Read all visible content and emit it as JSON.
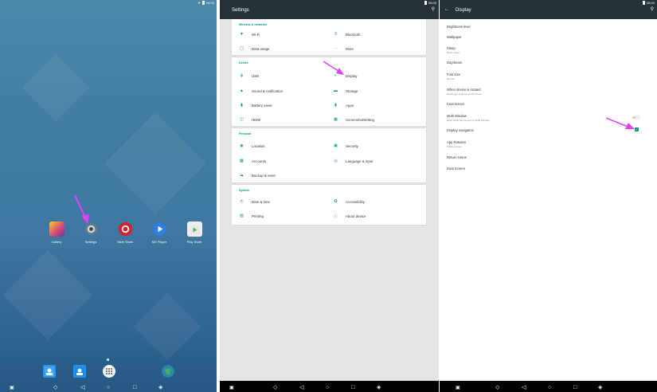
{
  "status": {
    "time": "08:00"
  },
  "home": {
    "apps": [
      {
        "label": "Gallery",
        "icon": "gallery-icon",
        "color": "#d94a7a"
      },
      {
        "label": "Settings",
        "icon": "gear-icon",
        "color": "#546e7a"
      },
      {
        "label": "Slide Show",
        "icon": "slideshow-icon",
        "color": "#e01b2d"
      },
      {
        "label": "MX Player",
        "icon": "play-icon",
        "color": "#2f7de0"
      },
      {
        "label": "Play Store",
        "icon": "play-store-icon",
        "color": "#f0f0f0"
      }
    ],
    "dock": [
      {
        "icon": "contacts-icon"
      },
      {
        "icon": "contacts2-icon"
      },
      {
        "icon": "app-drawer-icon"
      },
      {
        "icon": "browser-globe-icon"
      }
    ],
    "nav": [
      "screenshot-icon",
      "volume-down-icon",
      "back-icon",
      "home-icon",
      "recents-icon",
      "volume-up-icon"
    ]
  },
  "settings": {
    "title": "Settings",
    "sections": [
      {
        "header": "Wireless & networks",
        "items": [
          {
            "label": "Wi-Fi",
            "icon": "wifi-icon"
          },
          {
            "label": "Bluetooth",
            "icon": "bluetooth-icon"
          },
          {
            "label": "Data usage",
            "icon": "data-usage-icon"
          },
          {
            "label": "More",
            "icon": "more-icon"
          }
        ]
      },
      {
        "header": "Device",
        "items": [
          {
            "label": "USB",
            "icon": "usb-icon"
          },
          {
            "label": "Display",
            "icon": "display-icon"
          },
          {
            "label": "Sound & notification",
            "icon": "sound-icon"
          },
          {
            "label": "Storage",
            "icon": "storage-icon"
          },
          {
            "label": "Battery saver",
            "icon": "battery-icon"
          },
          {
            "label": "Apps",
            "icon": "apps-icon"
          },
          {
            "label": "HDMI",
            "icon": "hdmi-icon"
          },
          {
            "label": "ScreenshotSetting",
            "icon": "screenshot-setting-icon"
          }
        ]
      },
      {
        "header": "Personal",
        "items": [
          {
            "label": "Location",
            "icon": "location-icon"
          },
          {
            "label": "Security",
            "icon": "lock-icon"
          },
          {
            "label": "Accounts",
            "icon": "account-icon"
          },
          {
            "label": "Language & input",
            "icon": "globe-icon"
          },
          {
            "label": "Backup & reset",
            "icon": "cloud-icon"
          }
        ]
      },
      {
        "header": "System",
        "items": [
          {
            "label": "Date & time",
            "icon": "clock-icon"
          },
          {
            "label": "Accessibility",
            "icon": "accessibility-icon"
          },
          {
            "label": "Printing",
            "icon": "printer-icon"
          },
          {
            "label": "About device",
            "icon": "info-icon"
          }
        ]
      }
    ]
  },
  "display": {
    "title": "Display",
    "prefs": [
      {
        "title": "Brightness level",
        "summary": ""
      },
      {
        "title": "Wallpaper",
        "summary": ""
      },
      {
        "title": "Sleep",
        "summary": "Never sleep"
      },
      {
        "title": "Daydream",
        "summary": ""
      },
      {
        "title": "Font size",
        "summary": "Normal"
      },
      {
        "title": "When device is rotated",
        "summary": "Rotate the contents of the screen"
      },
      {
        "title": "Cast screen",
        "summary": ""
      },
      {
        "title": "Multi Window",
        "summary": "Open show the function of Multi Window"
      },
      {
        "title": "Display navigation",
        "summary": ""
      },
      {
        "title": "App Rotation",
        "summary": "Follow system"
      },
      {
        "title": "Return Home",
        "summary": ""
      },
      {
        "title": "Dual Screen",
        "summary": ""
      }
    ],
    "multi_window_enabled": false,
    "display_navigation_checked": true
  },
  "colors": {
    "accent": "#009688",
    "appbar": "#263238",
    "arrow": "#e040fb"
  }
}
